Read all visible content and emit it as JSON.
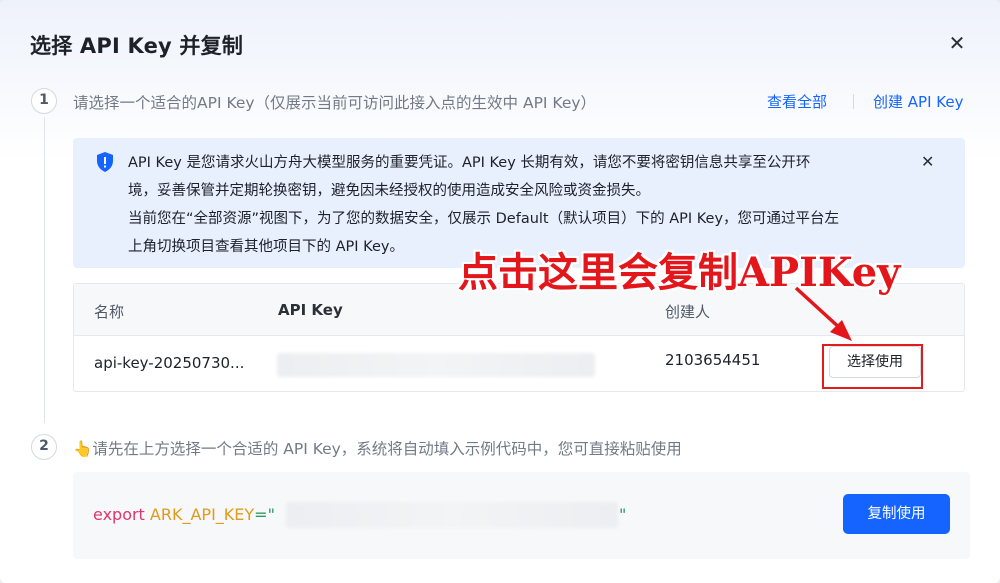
{
  "modal": {
    "title": "选择 API Key 并复制",
    "close_icon": "close-icon"
  },
  "step1": {
    "number": "1",
    "text": "请选择一个适合的API Key（仅展示当前可访问此接入点的生效中 API Key）",
    "view_all": "查看全部",
    "create_key": "创建 API Key"
  },
  "alert": {
    "icon": "shield-icon",
    "line1": "API Key 是您请求火山方舟大模型服务的重要凭证。API Key 长期有效，请您不要将密钥信息共享至公开环",
    "line2": "境，妥善保管并定期轮换密钥，避免因未经授权的使用造成安全风险或资金损失。",
    "line3": "当前您在“全部资源”视图下，为了您的数据安全，仅展示 Default（默认项目）下的 API Key，您可通过平台左",
    "line4": "上角切换项目查看其他项目下的 API Key。"
  },
  "table": {
    "headers": {
      "name": "名称",
      "api_key": "API Key",
      "creator": "创建人"
    },
    "rows": [
      {
        "name": "api-key-20250730...",
        "creator": "2103654451",
        "action": "选择使用"
      }
    ]
  },
  "annotation": {
    "text": "点击这里会复制APIKey",
    "color": "#e2161b"
  },
  "step2": {
    "number": "2",
    "emoji": "👆",
    "text": "请先在上方选择一个合适的 API Key，系统将自动填入示例代码中，您可直接粘贴使用"
  },
  "code": {
    "keyword": "export",
    "variable": "ARK_API_KEY",
    "operator": "=",
    "quote_open": "\"",
    "quote_close": "\"",
    "copy_button": "复制使用"
  },
  "colors": {
    "accent": "#1664ff",
    "alert_bg": "#e8f0fd",
    "annotation_red": "#e2161b"
  }
}
